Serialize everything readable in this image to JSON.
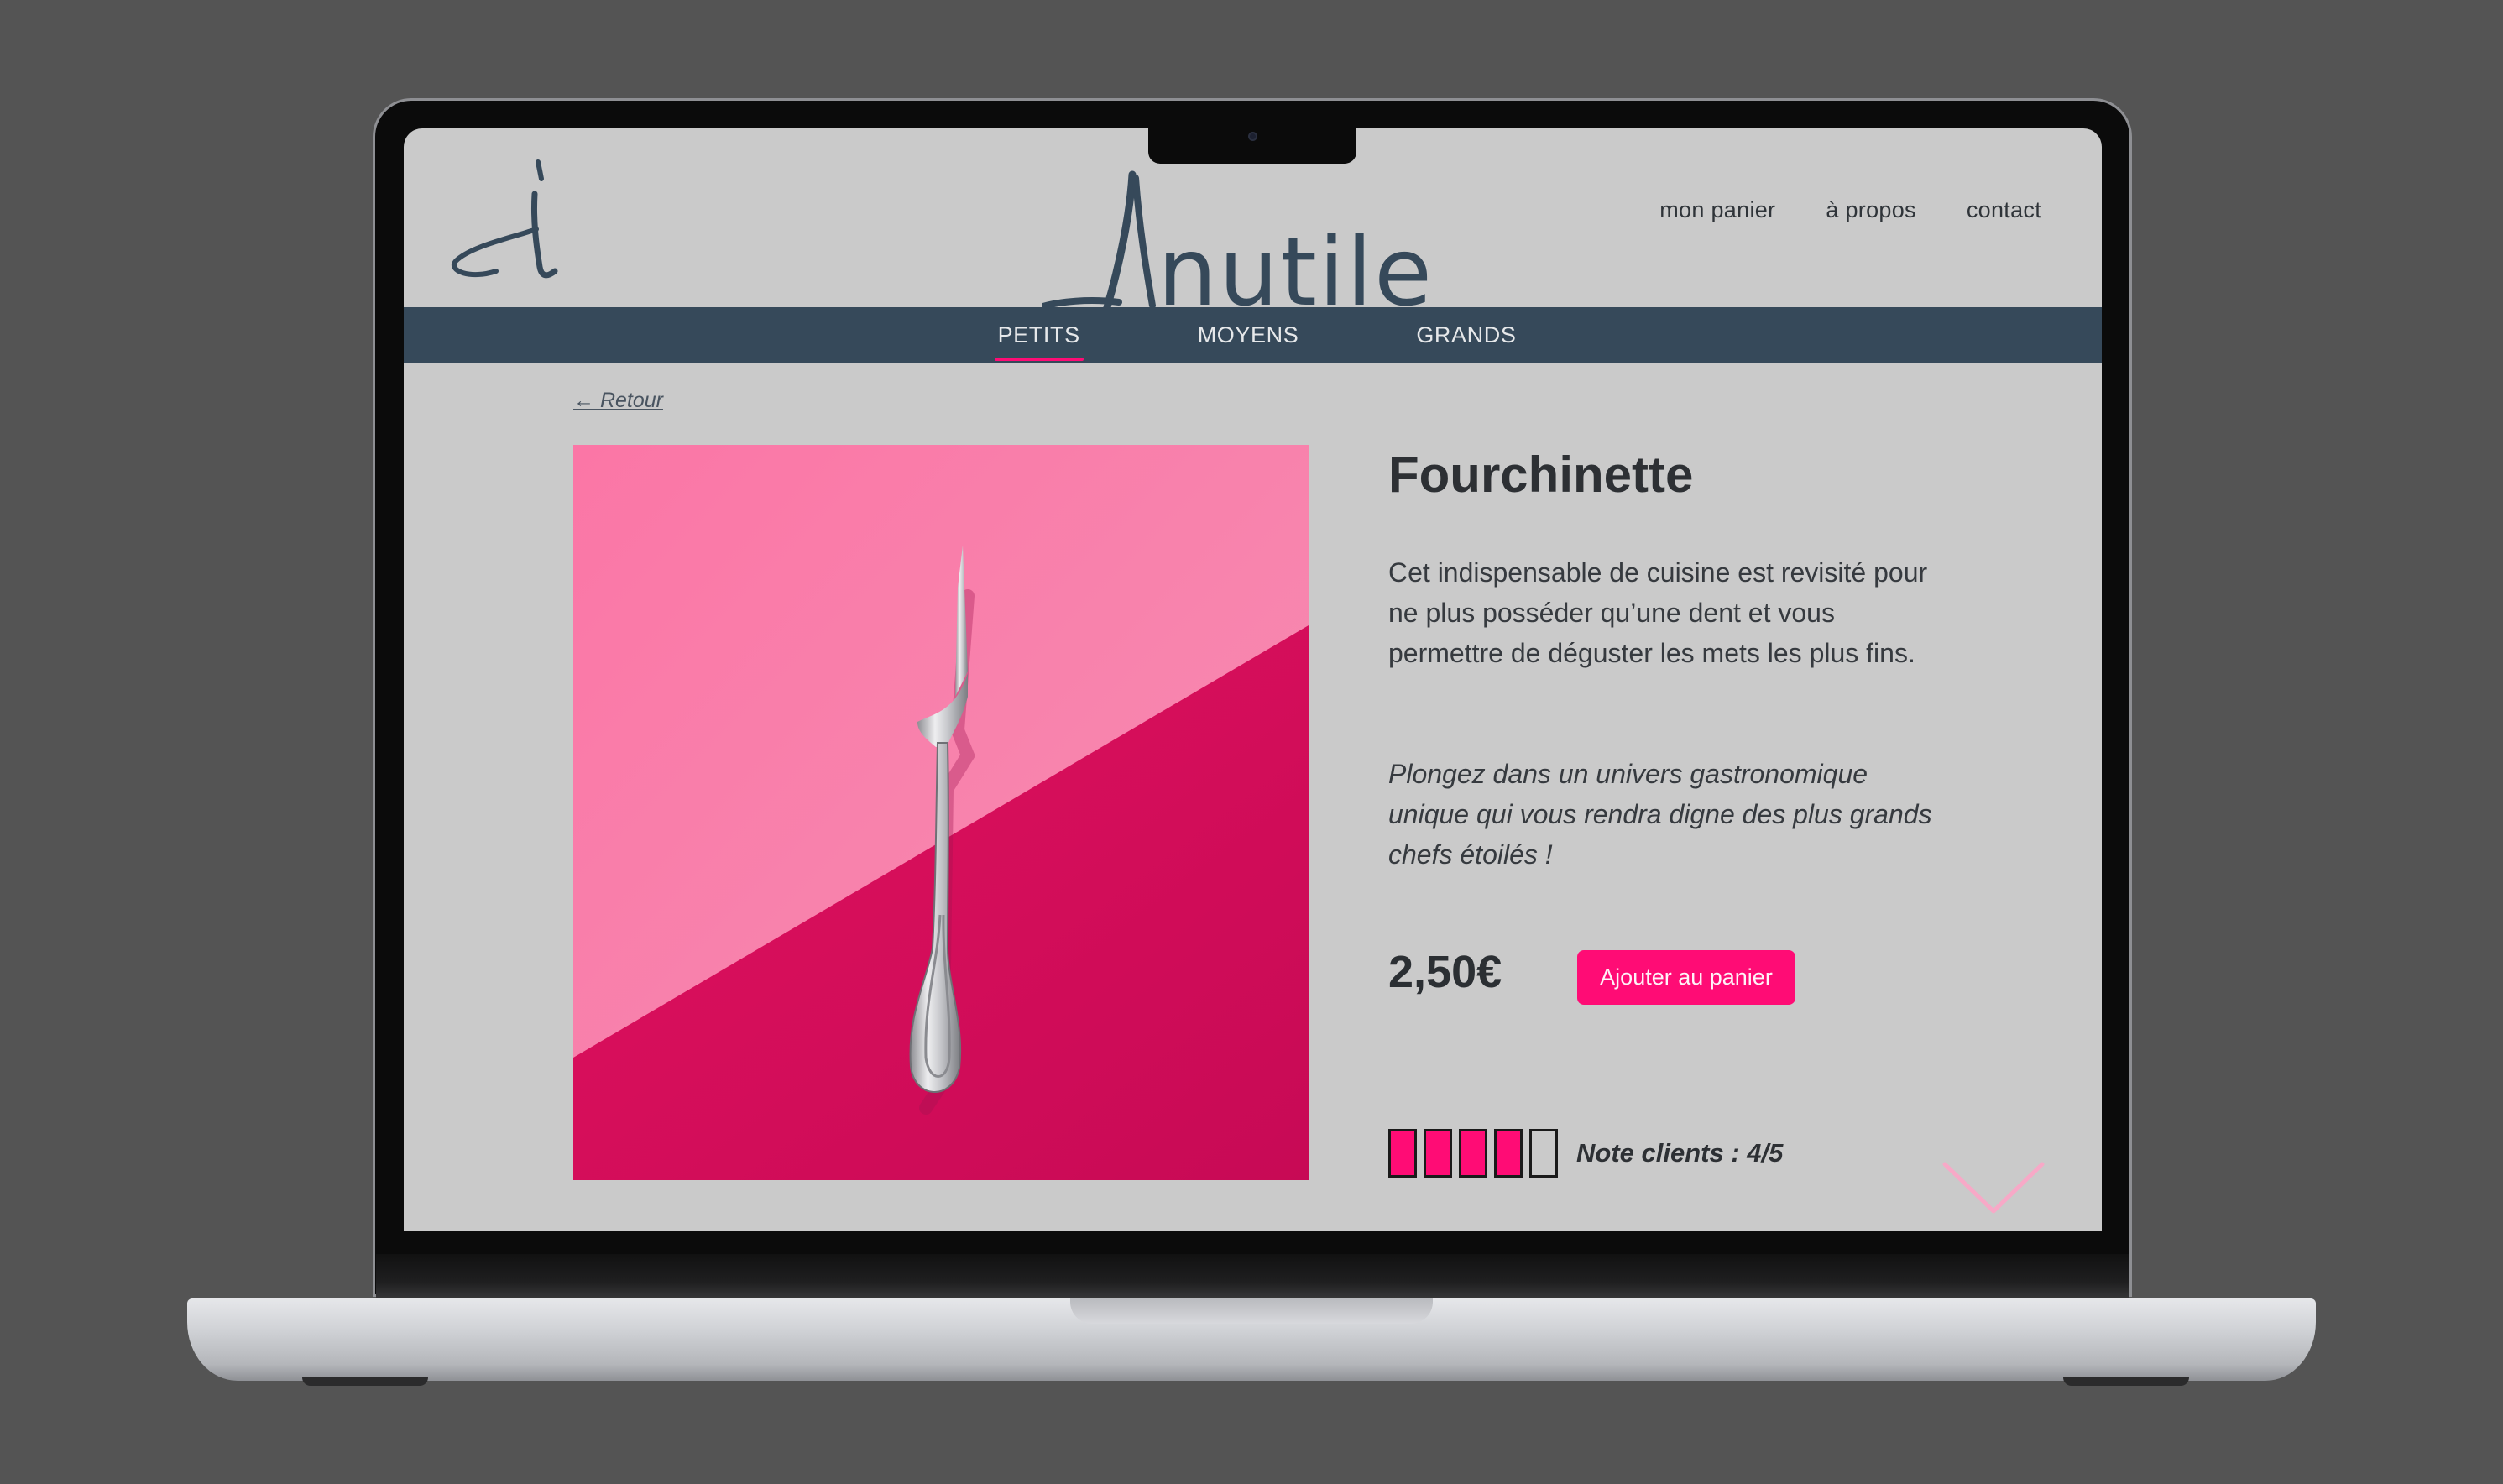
{
  "brand": {
    "logo_mark": "i",
    "wordmark": "Inutile"
  },
  "top_nav": {
    "cart": "mon panier",
    "about": "à propos",
    "contact": "contact"
  },
  "categories": [
    {
      "label": "PETITS",
      "active": true
    },
    {
      "label": "MOYENS",
      "active": false
    },
    {
      "label": "GRANDS",
      "active": false
    }
  ],
  "back_link": "← Retour",
  "product": {
    "title": "Fourchinette",
    "description": "Cet indispensable de cuisine est revisité pour ne plus posséder qu’une dent et vous permettre de déguster les mets les plus fins.",
    "tagline": "Plongez dans un univers gastronomique unique qui vous rendra digne des plus grands chefs étoilés !",
    "price": "2,50€",
    "add_to_cart_label": "Ajouter au panier",
    "rating_value": 4,
    "rating_max": 5,
    "rating_label": "Note clients : 4/5",
    "image_subject": "single-tine-fork-on-pink-background"
  },
  "icons": {
    "scroll": "chevron-down-icon"
  },
  "colors": {
    "accent": "#ff0c75",
    "nav_bar": "#36495a",
    "page_bg": "#cacaca",
    "text": "#2d3034"
  }
}
